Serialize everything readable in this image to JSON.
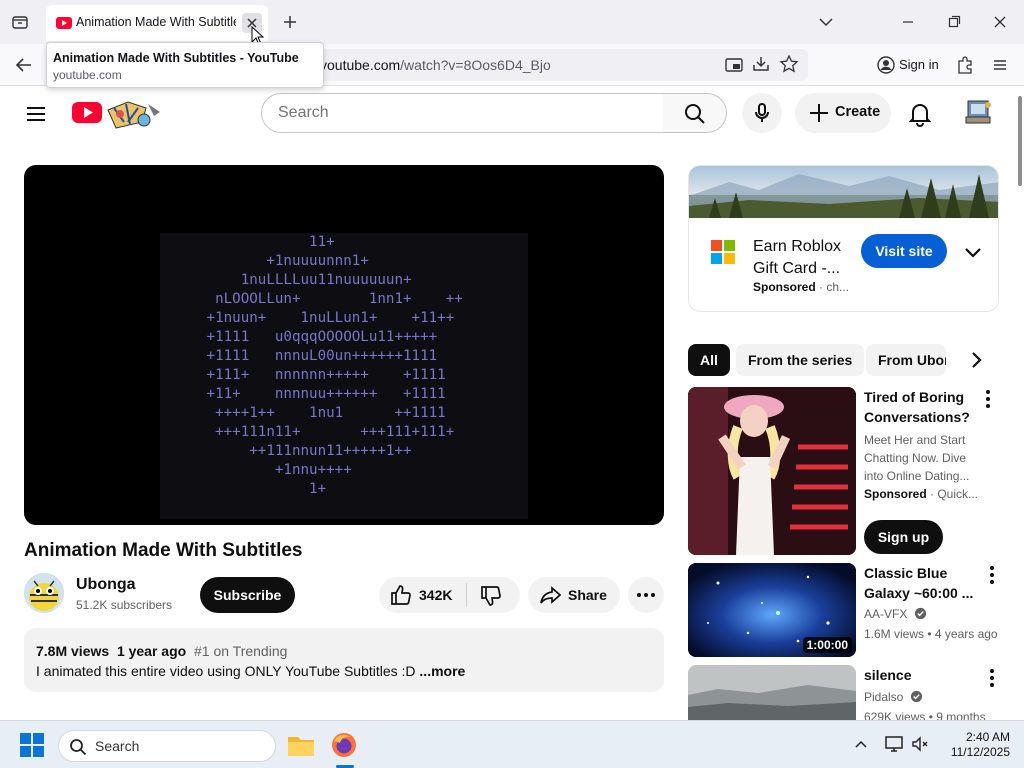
{
  "browser": {
    "tab_title": "Animation Made With Subtitles",
    "tooltip_title": "Animation Made With Subtitles - YouTube",
    "tooltip_host": "youtube.com",
    "url_host": "youtube.com",
    "url_path": "/watch?v=8Oos6D4_Bjo",
    "signin_label": "Sign in"
  },
  "yt_header": {
    "search_placeholder": "Search",
    "create_label": "Create"
  },
  "video": {
    "title": "Animation Made With Subtitles",
    "channel": "Ubonga",
    "subscribers": "51.2K subscribers",
    "subscribe_label": "Subscribe",
    "likes": "342K",
    "share_label": "Share",
    "views": "7.8M views",
    "age": "1 year ago",
    "trending": "#1 on Trending",
    "description": "I animated this entire video using ONLY YouTube Subtitles :D",
    "more_label": "...more",
    "ascii_lines": [
      "             11+",
      "        +1nuuuunnn1+",
      "     1nuLLLLuu11nuuuuuun+",
      "  nLOOOLLun+        1nn1+    ++",
      " +1nuun+    1nuLLun1+    +11++",
      " +1111   u0qqqOOOOOLu11+++++",
      " +1111   nnnuL00un++++++1111",
      " +111+   nnnnnn+++++    +1111",
      " +11+    nnnnuu++++++   +1111",
      "  ++++1++    1nu1      ++1111",
      "  +++111n11+       +++111+111+",
      "      ++111nnun11+++++1++",
      "         +1nnu++++",
      "             1+"
    ]
  },
  "ad": {
    "title": "Earn Roblox Gift Card -...",
    "sponsored": "Sponsored",
    "advertiser": "ch...",
    "visit_label": "Visit site"
  },
  "chips": [
    "All",
    "From the series",
    "From Ubon"
  ],
  "recommendations": [
    {
      "title": "Tired of Boring Conversations?",
      "desc": "Meet Her and Start Chatting Now. Dive into Online Dating...",
      "sponsored": "Sponsored",
      "advertiser": "Quick...",
      "cta": "Sign up"
    },
    {
      "title": "Classic Blue Galaxy ~60:00 ...",
      "channel": "AA-VFX",
      "stats": "1.6M views • 4 years ago",
      "duration": "1:00:00"
    },
    {
      "title": "silence",
      "channel": "Pidalso",
      "stats": "629K views • 9 months"
    }
  ],
  "taskbar": {
    "search_label": "Search",
    "time": "2:40 AM",
    "date": "11/12/2025"
  },
  "colors": {
    "yt_red": "#ff0033",
    "visit_blue": "#065fd4",
    "ascii_purple": "#7b74c9"
  }
}
